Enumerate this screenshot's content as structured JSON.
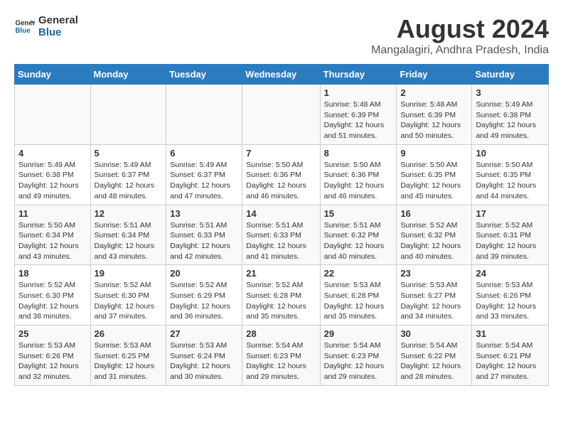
{
  "logo": {
    "line1": "General",
    "line2": "Blue"
  },
  "title": "August 2024",
  "location": "Mangalagiri, Andhra Pradesh, India",
  "headers": [
    "Sunday",
    "Monday",
    "Tuesday",
    "Wednesday",
    "Thursday",
    "Friday",
    "Saturday"
  ],
  "weeks": [
    [
      {
        "day": "",
        "detail": ""
      },
      {
        "day": "",
        "detail": ""
      },
      {
        "day": "",
        "detail": ""
      },
      {
        "day": "",
        "detail": ""
      },
      {
        "day": "1",
        "detail": "Sunrise: 5:48 AM\nSunset: 6:39 PM\nDaylight: 12 hours\nand 51 minutes."
      },
      {
        "day": "2",
        "detail": "Sunrise: 5:48 AM\nSunset: 6:39 PM\nDaylight: 12 hours\nand 50 minutes."
      },
      {
        "day": "3",
        "detail": "Sunrise: 5:49 AM\nSunset: 6:38 PM\nDaylight: 12 hours\nand 49 minutes."
      }
    ],
    [
      {
        "day": "4",
        "detail": "Sunrise: 5:49 AM\nSunset: 6:38 PM\nDaylight: 12 hours\nand 49 minutes."
      },
      {
        "day": "5",
        "detail": "Sunrise: 5:49 AM\nSunset: 6:37 PM\nDaylight: 12 hours\nand 48 minutes."
      },
      {
        "day": "6",
        "detail": "Sunrise: 5:49 AM\nSunset: 6:37 PM\nDaylight: 12 hours\nand 47 minutes."
      },
      {
        "day": "7",
        "detail": "Sunrise: 5:50 AM\nSunset: 6:36 PM\nDaylight: 12 hours\nand 46 minutes."
      },
      {
        "day": "8",
        "detail": "Sunrise: 5:50 AM\nSunset: 6:36 PM\nDaylight: 12 hours\nand 46 minutes."
      },
      {
        "day": "9",
        "detail": "Sunrise: 5:50 AM\nSunset: 6:35 PM\nDaylight: 12 hours\nand 45 minutes."
      },
      {
        "day": "10",
        "detail": "Sunrise: 5:50 AM\nSunset: 6:35 PM\nDaylight: 12 hours\nand 44 minutes."
      }
    ],
    [
      {
        "day": "11",
        "detail": "Sunrise: 5:50 AM\nSunset: 6:34 PM\nDaylight: 12 hours\nand 43 minutes."
      },
      {
        "day": "12",
        "detail": "Sunrise: 5:51 AM\nSunset: 6:34 PM\nDaylight: 12 hours\nand 43 minutes."
      },
      {
        "day": "13",
        "detail": "Sunrise: 5:51 AM\nSunset: 6:33 PM\nDaylight: 12 hours\nand 42 minutes."
      },
      {
        "day": "14",
        "detail": "Sunrise: 5:51 AM\nSunset: 6:33 PM\nDaylight: 12 hours\nand 41 minutes."
      },
      {
        "day": "15",
        "detail": "Sunrise: 5:51 AM\nSunset: 6:32 PM\nDaylight: 12 hours\nand 40 minutes."
      },
      {
        "day": "16",
        "detail": "Sunrise: 5:52 AM\nSunset: 6:32 PM\nDaylight: 12 hours\nand 40 minutes."
      },
      {
        "day": "17",
        "detail": "Sunrise: 5:52 AM\nSunset: 6:31 PM\nDaylight: 12 hours\nand 39 minutes."
      }
    ],
    [
      {
        "day": "18",
        "detail": "Sunrise: 5:52 AM\nSunset: 6:30 PM\nDaylight: 12 hours\nand 38 minutes."
      },
      {
        "day": "19",
        "detail": "Sunrise: 5:52 AM\nSunset: 6:30 PM\nDaylight: 12 hours\nand 37 minutes."
      },
      {
        "day": "20",
        "detail": "Sunrise: 5:52 AM\nSunset: 6:29 PM\nDaylight: 12 hours\nand 36 minutes."
      },
      {
        "day": "21",
        "detail": "Sunrise: 5:52 AM\nSunset: 6:28 PM\nDaylight: 12 hours\nand 35 minutes."
      },
      {
        "day": "22",
        "detail": "Sunrise: 5:53 AM\nSunset: 6:28 PM\nDaylight: 12 hours\nand 35 minutes."
      },
      {
        "day": "23",
        "detail": "Sunrise: 5:53 AM\nSunset: 6:27 PM\nDaylight: 12 hours\nand 34 minutes."
      },
      {
        "day": "24",
        "detail": "Sunrise: 5:53 AM\nSunset: 6:26 PM\nDaylight: 12 hours\nand 33 minutes."
      }
    ],
    [
      {
        "day": "25",
        "detail": "Sunrise: 5:53 AM\nSunset: 6:26 PM\nDaylight: 12 hours\nand 32 minutes."
      },
      {
        "day": "26",
        "detail": "Sunrise: 5:53 AM\nSunset: 6:25 PM\nDaylight: 12 hours\nand 31 minutes."
      },
      {
        "day": "27",
        "detail": "Sunrise: 5:53 AM\nSunset: 6:24 PM\nDaylight: 12 hours\nand 30 minutes."
      },
      {
        "day": "28",
        "detail": "Sunrise: 5:54 AM\nSunset: 6:23 PM\nDaylight: 12 hours\nand 29 minutes."
      },
      {
        "day": "29",
        "detail": "Sunrise: 5:54 AM\nSunset: 6:23 PM\nDaylight: 12 hours\nand 29 minutes."
      },
      {
        "day": "30",
        "detail": "Sunrise: 5:54 AM\nSunset: 6:22 PM\nDaylight: 12 hours\nand 28 minutes."
      },
      {
        "day": "31",
        "detail": "Sunrise: 5:54 AM\nSunset: 6:21 PM\nDaylight: 12 hours\nand 27 minutes."
      }
    ]
  ]
}
